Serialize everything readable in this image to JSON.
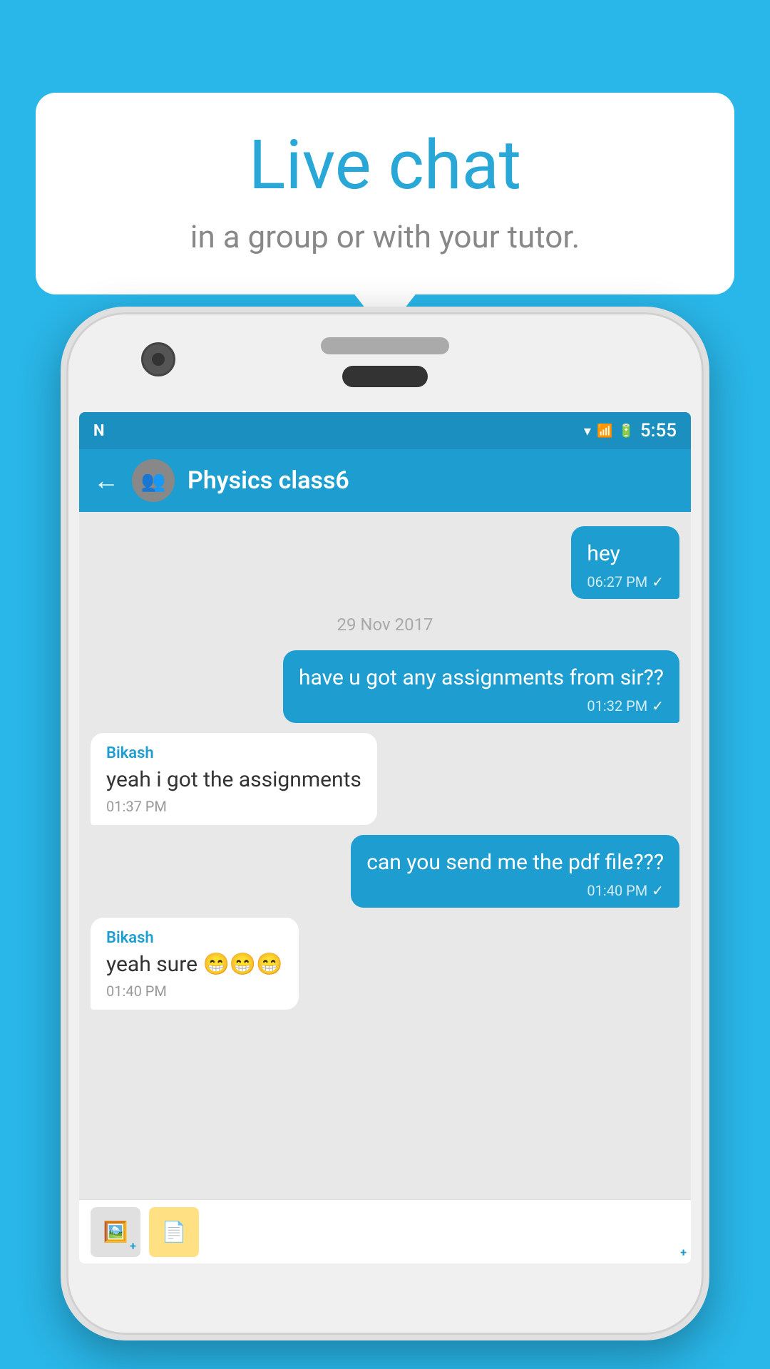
{
  "background": {
    "color": "#29b6e8"
  },
  "speech_bubble": {
    "title": "Live chat",
    "subtitle": "in a group or with your tutor."
  },
  "status_bar": {
    "time": "5:55",
    "notification_icon": "N",
    "wifi": "▾",
    "battery": "⚡"
  },
  "toolbar": {
    "back_label": "←",
    "group_name": "Physics class6"
  },
  "messages": [
    {
      "id": "msg1",
      "type": "out",
      "text": "hey",
      "time": "06:27 PM",
      "tick": "✓"
    },
    {
      "id": "date1",
      "type": "date",
      "text": "29  Nov  2017"
    },
    {
      "id": "msg2",
      "type": "out",
      "text": "have u got any assignments from sir??",
      "time": "01:32 PM",
      "tick": "✓"
    },
    {
      "id": "msg3",
      "type": "in",
      "sender": "Bikash",
      "text": "yeah i got the assignments",
      "time": "01:37 PM"
    },
    {
      "id": "msg4",
      "type": "out",
      "text": "can you send me the pdf file???",
      "time": "01:40 PM",
      "tick": "✓"
    },
    {
      "id": "msg5",
      "type": "in",
      "sender": "Bikash",
      "text": "yeah sure 😁😁😁",
      "time": "01:40 PM"
    }
  ],
  "bottom_bar": {
    "attach1_icon": "🖼",
    "attach2_icon": "📄"
  }
}
